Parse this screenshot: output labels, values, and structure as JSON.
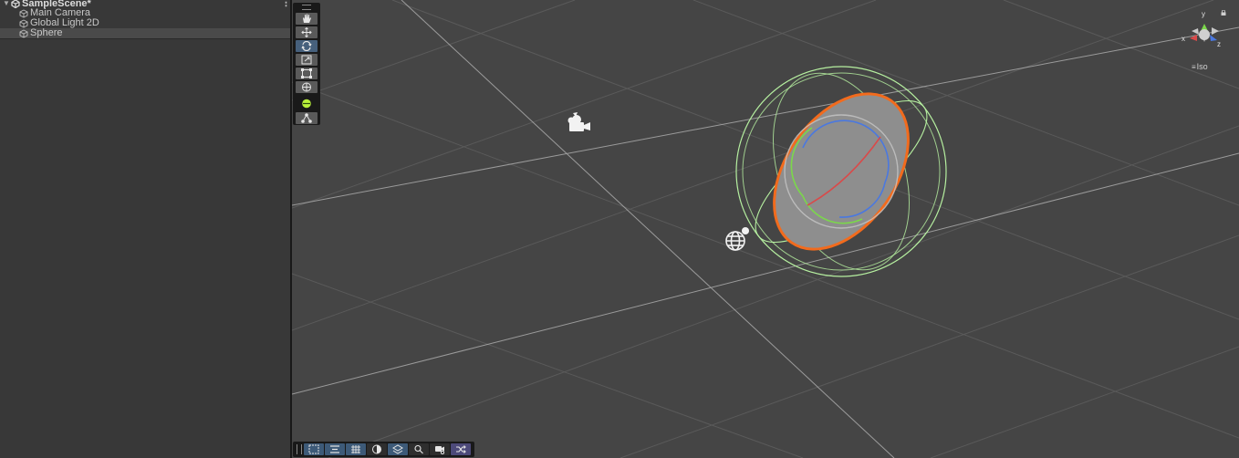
{
  "hierarchy": {
    "scene_name": "SampleScene*",
    "menu_glyph": "⋮",
    "items": [
      {
        "label": "Main Camera",
        "icon": "gameobject-cube-icon",
        "selected": false
      },
      {
        "label": "Global Light 2D",
        "icon": "gameobject-cube-icon",
        "selected": false
      },
      {
        "label": "Sphere",
        "icon": "gameobject-cube-icon",
        "selected": true
      }
    ]
  },
  "scene_view": {
    "tools": [
      {
        "name": "hand-tool",
        "icon": "hand-icon",
        "active": false
      },
      {
        "name": "move-tool",
        "icon": "move-arrows-icon",
        "active": false
      },
      {
        "name": "rotate-tool",
        "icon": "rotate-icon",
        "active": true
      },
      {
        "name": "scale-tool",
        "icon": "scale-icon",
        "active": false
      },
      {
        "name": "rect-tool",
        "icon": "rect-icon",
        "active": false
      },
      {
        "name": "transform-tool",
        "icon": "transform-icon",
        "active": false
      },
      {
        "name": "custom-tool",
        "icon": "green-sphere-icon",
        "active": false
      },
      {
        "name": "pivot-tool",
        "icon": "pivot-icon",
        "active": false
      }
    ],
    "overlay_buttons": [
      {
        "name": "rect-select",
        "icon": "rect-select-icon"
      },
      {
        "name": "align",
        "icon": "align-icon"
      },
      {
        "name": "grid",
        "icon": "grid-icon"
      },
      {
        "name": "shading",
        "icon": "shading-sphere-icon"
      },
      {
        "name": "layers",
        "icon": "layers-icon"
      },
      {
        "name": "search",
        "icon": "magnifier-icon"
      },
      {
        "name": "scene-camera",
        "icon": "camera-settings-icon"
      },
      {
        "name": "shuffle",
        "icon": "shuffle-icon"
      }
    ],
    "gizmo": {
      "axis_y": "y",
      "axis_x": "x",
      "axis_z": "z",
      "projection": "Iso",
      "menu_glyph": "≡"
    },
    "colors": {
      "x_axis": "#d94a4a",
      "y_axis": "#7bd84a",
      "z_axis": "#4a78e0",
      "selection_outline": "#f26b1d",
      "gizmo_sphere": "#b6f0a0"
    }
  }
}
